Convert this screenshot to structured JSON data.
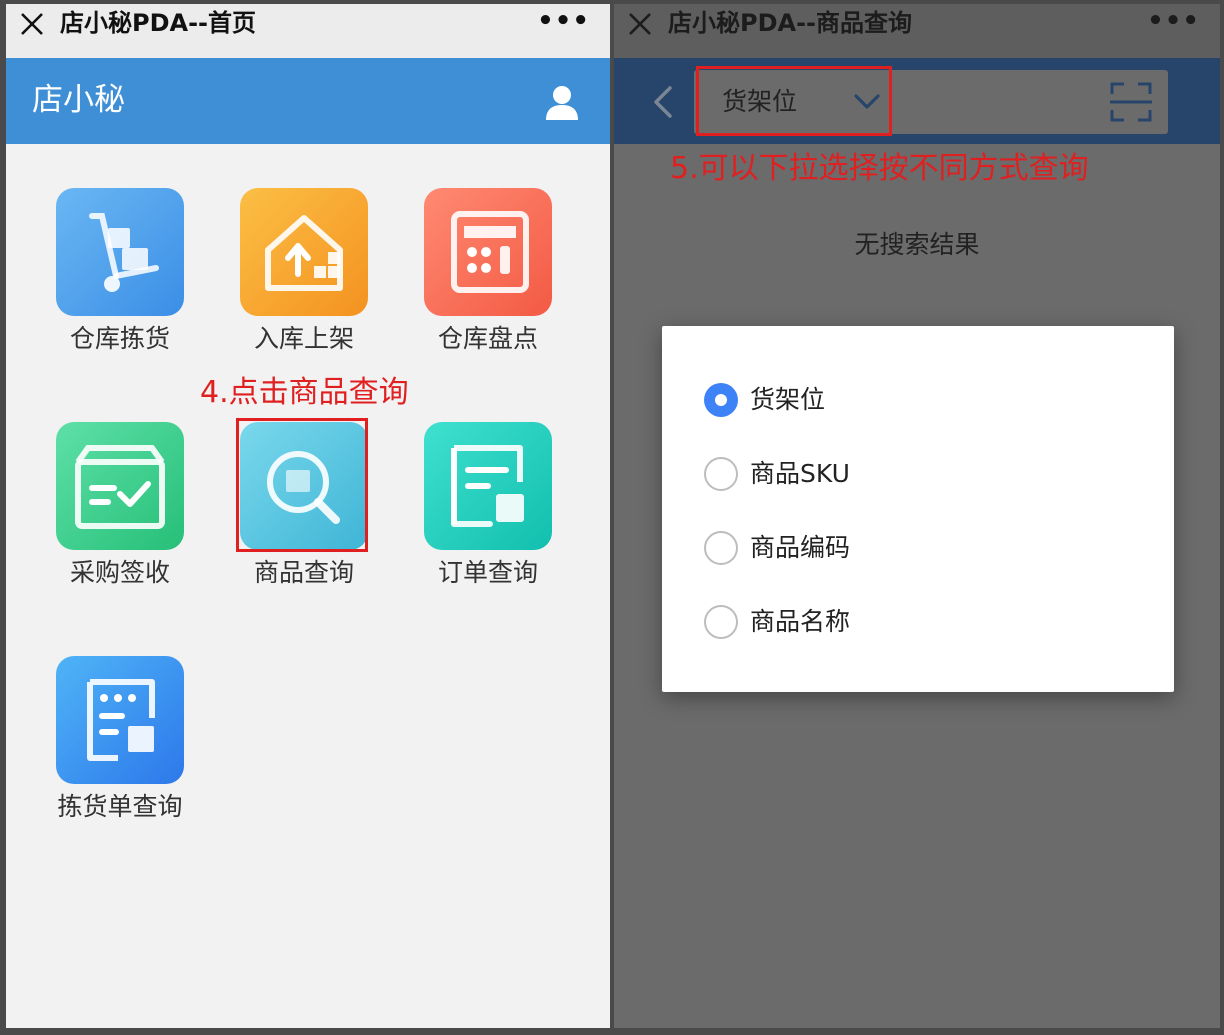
{
  "left_screen": {
    "window_title": "店小秘PDA--首页",
    "more_label": "•••",
    "app_title": "店小秘",
    "grid": [
      {
        "label": "仓库拣货",
        "icon": "warehouse-picking-icon",
        "color": "#4aa2ea"
      },
      {
        "label": "入库上架",
        "icon": "inbound-shelving-icon",
        "color": "#f7a72a"
      },
      {
        "label": "仓库盘点",
        "icon": "inventory-count-icon",
        "color": "#f66a4f"
      },
      {
        "label": "采购签收",
        "icon": "purchase-receipt-icon",
        "color": "#3ccf8e"
      },
      {
        "label": "商品查询",
        "icon": "product-search-icon",
        "color": "#56c6e0"
      },
      {
        "label": "订单查询",
        "icon": "order-query-icon",
        "color": "#1fcfc0"
      },
      {
        "label": "拣货单查询",
        "icon": "pick-list-query-icon",
        "color": "#3a8df0"
      }
    ],
    "annotation": "4.点击商品查询"
  },
  "right_screen": {
    "window_title": "店小秘PDA--商品查询",
    "more_label": "•••",
    "select_value": "货架位",
    "annotation": "5.可以下拉选择按不同方式查询",
    "no_result": "无搜索结果",
    "options": [
      {
        "label": "货架位",
        "checked": true
      },
      {
        "label": "商品SKU",
        "checked": false
      },
      {
        "label": "商品编码",
        "checked": false
      },
      {
        "label": "商品名称",
        "checked": false
      }
    ]
  },
  "colors": {
    "header_blue": "#3f8fd6",
    "annotation_red": "#e02020",
    "radio_selected": "#3e82f7"
  }
}
